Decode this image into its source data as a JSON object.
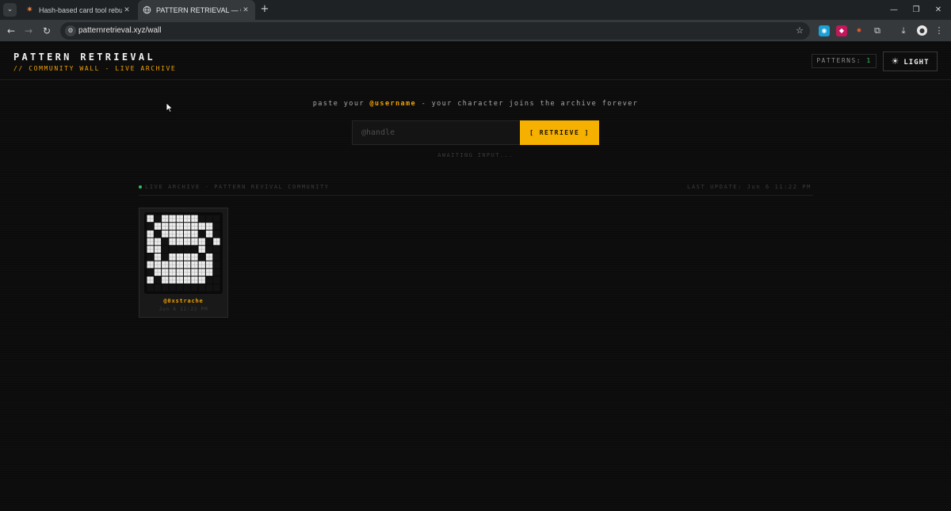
{
  "browser": {
    "tabs": [
      {
        "title": "Hash-based card tool rebuild -",
        "favicon": "sparkle-icon",
        "active": false
      },
      {
        "title": "PATTERN RETRIEVAL — Commu",
        "favicon": "globe-icon",
        "active": true
      }
    ],
    "url": "patternretrieval.xyz/wall"
  },
  "header": {
    "title": "PATTERN RETRIEVAL",
    "subtitle": "// COMMUNITY WALL - LIVE ARCHIVE",
    "count_label": "PATTERNS:",
    "count_value": "1",
    "theme_button_label": "LIGHT",
    "theme_button_icon": "sun-icon"
  },
  "retrieve": {
    "prompt_before": "paste your ",
    "prompt_highlight": "@username",
    "prompt_after": " - your character joins the archive forever",
    "input_placeholder": "@handle",
    "input_value": "",
    "button_label": "[ RETRIEVE ]",
    "status": "AWAITING INPUT..."
  },
  "archive": {
    "label": "LIVE ARCHIVE - PATTERN REVIVAL COMMUNITY",
    "last_update": "LAST UPDATE: Jun 6 11:22 PM",
    "cards": [
      {
        "handle": "@0xstrache",
        "date": "Jun 6 11:22 PM",
        "pattern": [
          "1011111000",
          "0111111110",
          "1011111010",
          "1101111101",
          "1100000100",
          "0101111010",
          "1111111110",
          "0111111110",
          "1011111100",
          "0000000000"
        ]
      }
    ]
  },
  "colors": {
    "accent": "#f5b000",
    "live": "#2fbf5c",
    "background": "#0c0c0c"
  }
}
